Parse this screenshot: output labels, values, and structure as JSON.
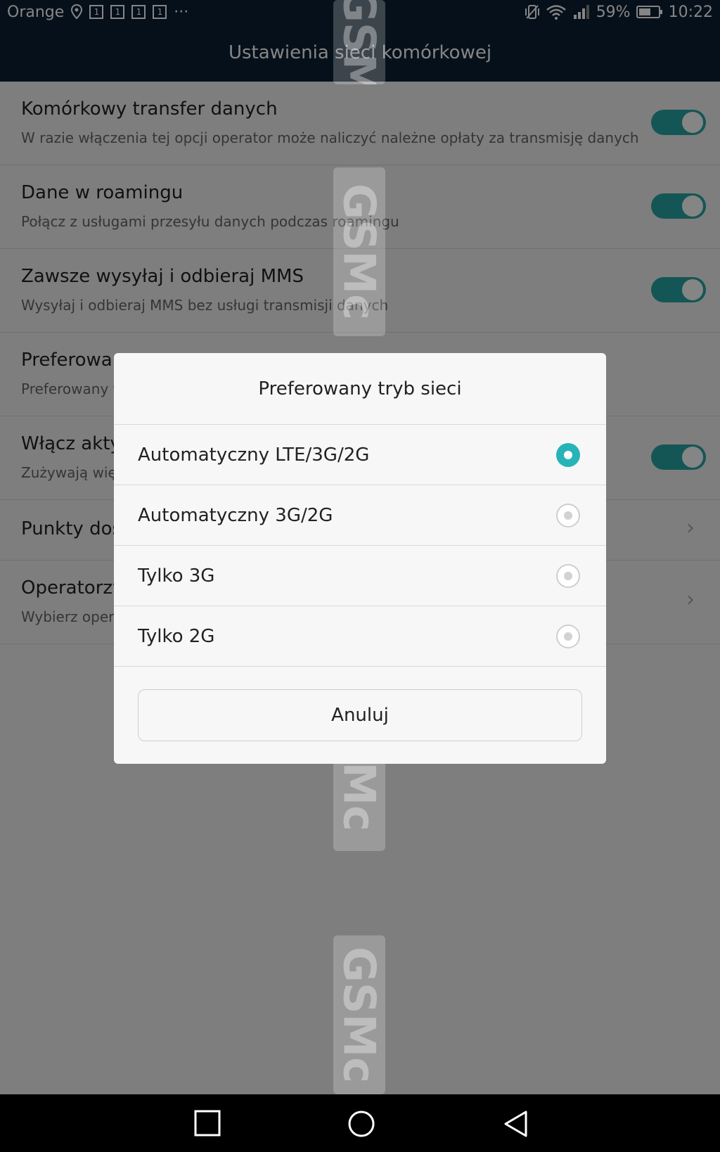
{
  "status_bar": {
    "carrier": "Orange",
    "notification_count_icons": [
      "1",
      "1",
      "1",
      "1"
    ],
    "more": "···",
    "battery": "59%",
    "time": "10:22"
  },
  "app_bar": {
    "title": "Ustawienia sieci komórkowej"
  },
  "settings": [
    {
      "title": "Komórkowy transfer danych",
      "subtitle": "W razie włączenia tej opcji operator może naliczyć należne opłaty za transmisję danych",
      "control": "toggle",
      "on": true
    },
    {
      "title": "Dane w roamingu",
      "subtitle": "Połącz z usługami przesyłu danych podczas roamingu",
      "control": "toggle",
      "on": true
    },
    {
      "title": "Zawsze wysyłaj i odbieraj MMS",
      "subtitle": "Wysyłaj i odbieraj MMS bez usługi transmisji danych",
      "control": "toggle",
      "on": true
    },
    {
      "title": "Preferowan",
      "subtitle": "Preferowany t",
      "control": "none"
    },
    {
      "title": "Włącz akty",
      "subtitle": "Zużywają wię",
      "control": "toggle",
      "on": true
    },
    {
      "title": "Punkty dos",
      "subtitle": "",
      "control": "chevron"
    },
    {
      "title": "Operatorzy",
      "subtitle": "Wybierz opera",
      "control": "chevron"
    }
  ],
  "dialog": {
    "title": "Preferowany tryb sieci",
    "options": [
      {
        "label": "Automatyczny LTE/3G/2G",
        "selected": true
      },
      {
        "label": "Automatyczny 3G/2G",
        "selected": false
      },
      {
        "label": "Tylko 3G",
        "selected": false
      },
      {
        "label": "Tylko 2G",
        "selected": false
      }
    ],
    "cancel_label": "Anuluj"
  },
  "watermark": [
    "GSM",
    "GSMc",
    "GSMc",
    "GSMc",
    "GSMc"
  ],
  "colors": {
    "accent": "#27a6a4",
    "header": "#0c1f33"
  }
}
